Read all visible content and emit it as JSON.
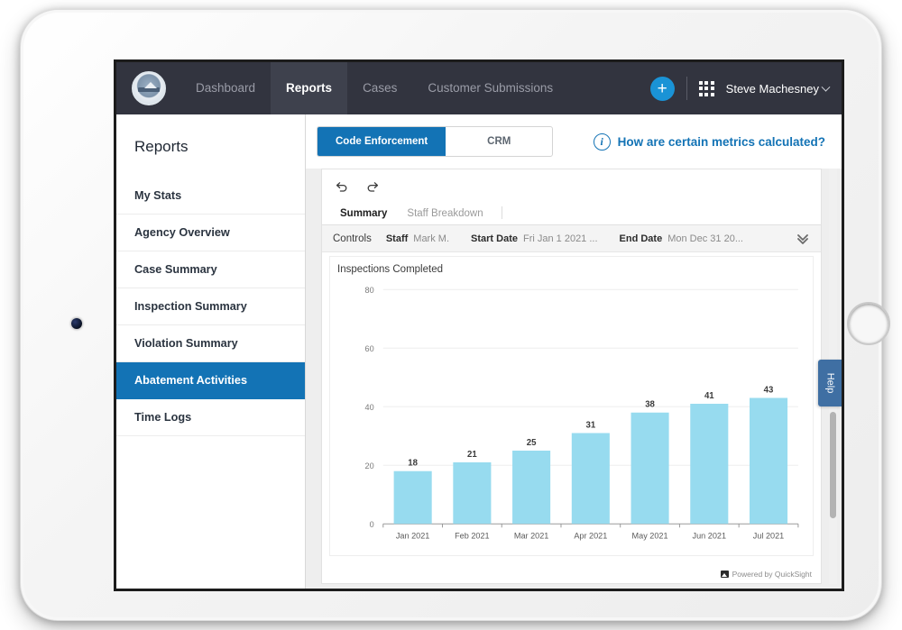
{
  "topnav": {
    "logo_alt": "city-seal-logo",
    "items": [
      {
        "label": "Dashboard",
        "active": false
      },
      {
        "label": "Reports",
        "active": true
      },
      {
        "label": "Cases",
        "active": false
      },
      {
        "label": "Customer Submissions",
        "active": false
      }
    ],
    "add_button_label": "+",
    "apps_icon": "apps-grid-icon",
    "username": "Steve Machesney"
  },
  "sidebar": {
    "title": "Reports",
    "items": [
      {
        "label": "My Stats",
        "active": false
      },
      {
        "label": "Agency Overview",
        "active": false
      },
      {
        "label": "Case Summary",
        "active": false
      },
      {
        "label": "Inspection Summary",
        "active": false
      },
      {
        "label": "Violation Summary",
        "active": false
      },
      {
        "label": "Abatement Activities",
        "active": true
      },
      {
        "label": "Time Logs",
        "active": false
      }
    ]
  },
  "content_header": {
    "toggles": [
      {
        "label": "Code Enforcement",
        "active": true
      },
      {
        "label": "CRM",
        "active": false
      }
    ],
    "info_icon": "info-circle-icon",
    "metrics_link": "How are certain metrics calculated?"
  },
  "dashboard": {
    "toolbar": {
      "undo_icon": "undo-icon",
      "redo_icon": "redo-icon"
    },
    "sheet_tabs": [
      {
        "label": "Summary",
        "active": true
      },
      {
        "label": "Staff Breakdown",
        "active": false
      }
    ],
    "controls": {
      "label": "Controls",
      "fields": [
        {
          "name": "Staff",
          "value": "Mark M."
        },
        {
          "name": "Start Date",
          "value": "Fri Jan 1 2021 ..."
        },
        {
          "name": "End Date",
          "value": "Mon Dec 31 20..."
        }
      ],
      "expand_icon": "double-chevron-down-icon"
    },
    "footer": "Powered by QuickSight",
    "help_tab": "Help"
  },
  "colors": {
    "nav_bg": "#32343f",
    "accent_blue": "#1373b5",
    "plus_blue": "#1a93d6",
    "bar_blue": "#97dbef",
    "help_blue": "#3f6fa3"
  },
  "chart_data": {
    "type": "bar",
    "title": "Inspections Completed",
    "xlabel": "",
    "ylabel": "",
    "categories": [
      "Jan 2021",
      "Feb 2021",
      "Mar 2021",
      "Apr 2021",
      "May 2021",
      "Jun 2021",
      "Jul 2021"
    ],
    "values": [
      18,
      21,
      25,
      31,
      38,
      41,
      43
    ],
    "ylim": [
      0,
      80
    ],
    "yticks": [
      0,
      20,
      40,
      60,
      80
    ],
    "grid": true,
    "legend": "none",
    "bar_color": "#97dbef",
    "data_labels": true
  }
}
